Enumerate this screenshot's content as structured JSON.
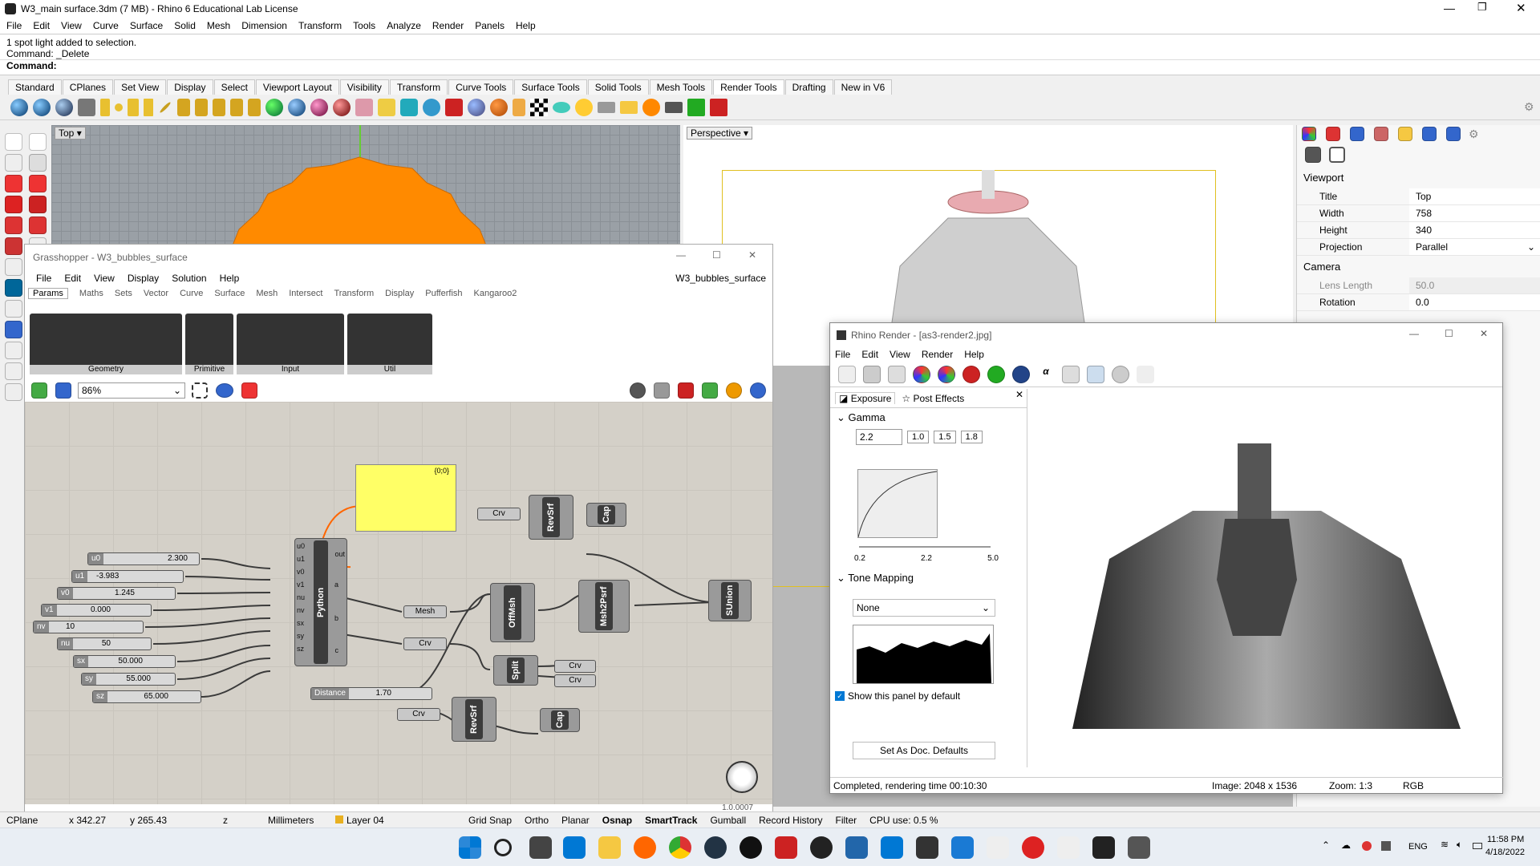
{
  "rhino": {
    "title": "W3_main surface.3dm (7 MB) - Rhino 6 Educational Lab License",
    "menu": [
      "File",
      "Edit",
      "View",
      "Curve",
      "Surface",
      "Solid",
      "Mesh",
      "Dimension",
      "Transform",
      "Tools",
      "Analyze",
      "Render",
      "Panels",
      "Help"
    ],
    "command_history": [
      "1 spot light added to selection.",
      "Command: _Delete"
    ],
    "command_prompt": "Command:",
    "toolbar_tabs": [
      "Standard",
      "CPlanes",
      "Set View",
      "Display",
      "Select",
      "Viewport Layout",
      "Visibility",
      "Transform",
      "Curve Tools",
      "Surface Tools",
      "Solid Tools",
      "Mesh Tools",
      "Render Tools",
      "Drafting",
      "New in V6"
    ],
    "active_tab": "Render Tools"
  },
  "viewports": {
    "top_label": "Top",
    "perspective_label": "Perspective"
  },
  "properties_panel": {
    "viewport_heading": "Viewport",
    "viewport_rows": [
      {
        "key": "Title",
        "value": "Top"
      },
      {
        "key": "Width",
        "value": "758"
      },
      {
        "key": "Height",
        "value": "340"
      },
      {
        "key": "Projection",
        "value": "Parallel"
      }
    ],
    "camera_heading": "Camera",
    "camera_rows": [
      {
        "key": "Lens Length",
        "value": "50.0"
      },
      {
        "key": "Rotation",
        "value": "0.0"
      }
    ]
  },
  "grasshopper": {
    "title": "Grasshopper - W3_bubbles_surface",
    "menu": [
      "File",
      "Edit",
      "View",
      "Display",
      "Solution",
      "Help"
    ],
    "doc_name": "W3_bubbles_surface",
    "tabs": [
      "Params",
      "Maths",
      "Sets",
      "Vector",
      "Curve",
      "Surface",
      "Mesh",
      "Intersect",
      "Transform",
      "Display",
      "Pufferfish",
      "Kangaroo2"
    ],
    "active_tab": "Params",
    "groups": [
      "Geometry",
      "Primitive",
      "Input",
      "Util"
    ],
    "zoom": "86%",
    "panel_text": "{0;0}",
    "version": "1.0.0007",
    "sliders": [
      {
        "name": "u0",
        "value": "2.300"
      },
      {
        "name": "u1",
        "value": "-3.983"
      },
      {
        "name": "v0",
        "value": "1.245"
      },
      {
        "name": "v1",
        "value": "0.000"
      },
      {
        "name": "nv",
        "value": "10"
      },
      {
        "name": "nu",
        "value": "50"
      },
      {
        "name": "sx",
        "value": "50.000"
      },
      {
        "name": "sy",
        "value": "55.000"
      },
      {
        "name": "sz",
        "value": "65.000"
      }
    ],
    "distance": {
      "name": "Distance",
      "value": "1.70"
    },
    "python": {
      "name": "Python",
      "inputs": [
        "u0",
        "u1",
        "v0",
        "v1",
        "nu",
        "nv",
        "sx",
        "sy",
        "sz"
      ],
      "outputs": [
        "out",
        "a",
        "b",
        "c"
      ]
    },
    "params": [
      "Mesh",
      "Crv",
      "Crv",
      "Crv",
      "Crv",
      "Crv"
    ],
    "components": [
      "RevSrf",
      "Cap",
      "OffMsh",
      "Msh2Psrf",
      "SUnion",
      "Split",
      "RevSrf",
      "Cap"
    ]
  },
  "render_window": {
    "title": "Rhino Render - [as3-render2.jpg]",
    "menu": [
      "File",
      "Edit",
      "View",
      "Render",
      "Help"
    ],
    "tab_exposure": "Exposure",
    "tab_post": "Post Effects",
    "gamma_heading": "Gamma",
    "gamma_value": "2.2",
    "gamma_presets": [
      "1.0",
      "1.5",
      "1.8"
    ],
    "gamma_axis": [
      "0.2",
      "2.2",
      "5.0"
    ],
    "tone_heading": "Tone Mapping",
    "tone_value": "None",
    "defaults_button": "Set As Doc. Defaults",
    "show_panel": "Show this panel by default",
    "status": "Completed, rendering time 00:10:30",
    "image_size": "Image: 2048 x 1536",
    "zoom": "Zoom: 1:3",
    "mode": "RGB"
  },
  "status_bar": {
    "cplane": "CPlane",
    "x": "x 342.27",
    "y": "y 265.43",
    "z": "z",
    "units": "Millimeters",
    "layer": "Layer 04",
    "toggles": [
      "Grid Snap",
      "Ortho",
      "Planar",
      "Osnap",
      "SmartTrack",
      "Gumball",
      "Record History",
      "Filter"
    ],
    "cpu": "CPU use: 0.5 %"
  },
  "taskbar": {
    "lang": "ENG",
    "time": "11:58 PM",
    "date": "4/18/2022"
  },
  "colors": {
    "accent": "#0078d4",
    "orange": "#ff8a00",
    "panel_yellow": "#ffff66",
    "canvas": "#d4d0c8"
  }
}
